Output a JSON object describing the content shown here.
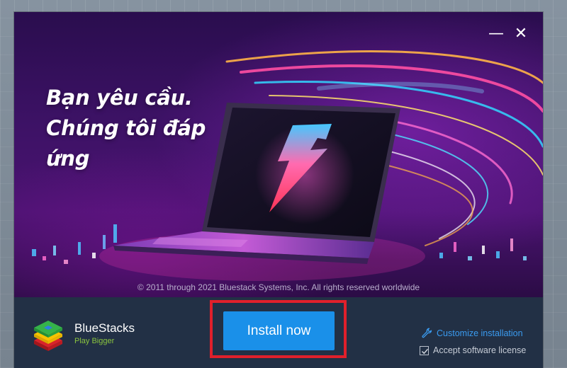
{
  "banner": {
    "headline_line1": "Bạn yêu cầu.",
    "headline_line2": "Chúng tôi đáp",
    "headline_line3": "ứng",
    "copyright": "© 2011 through 2021 Bluestack Systems, Inc. All rights reserved worldwide"
  },
  "window_controls": {
    "minimize_glyph": "—",
    "close_glyph": "✕"
  },
  "footer": {
    "brand_name": "BlueStacks",
    "brand_tagline": "Play Bigger",
    "install_button_label": "Install now",
    "customize_label": "Customize installation",
    "accept_label": "Accept software license",
    "accept_checked": true
  },
  "icons": {
    "logo": "bluestacks-logo-icon",
    "customize": "wrench-icon",
    "checkbox": "checkbox-icon",
    "laptop_logo": "lightning-logo-icon"
  },
  "colors": {
    "install_button": "#1a90e9",
    "highlight_border": "#e0202b",
    "footer_bg": "#223045",
    "link": "#3a9bf0",
    "tagline": "#8bc53f"
  }
}
